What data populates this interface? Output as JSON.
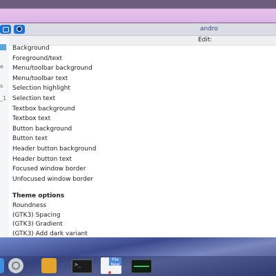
{
  "window": {
    "title": "andro",
    "edit_label": "Edit:",
    "sidebar_fragments": [
      "e",
      "s",
      "_1"
    ]
  },
  "color_items": [
    "Background",
    "Foreground/text",
    "Menu/toolbar background",
    "Menu/toolbar text",
    "Selection highlight",
    "Selection text",
    "Textbox background",
    "Textbox text",
    "Button background",
    "Button text",
    "Header button background",
    "Header button text",
    "Focused window border",
    "Unfocused window border"
  ],
  "theme_options": {
    "title": "Theme options",
    "items": [
      "Roundness",
      "(GTK3) Spacing",
      "(GTK3) Gradient",
      "(GTK3) Add dark variant"
    ]
  },
  "dock": {
    "file_tag": "File",
    "file_sub": "New"
  },
  "colors": {
    "accent": "#1d6fd8",
    "title_text": "#3a3f8a",
    "top_strip": "#e8c0ec"
  },
  "icons": [
    "edit-icon",
    "record-icon",
    "settings-icon",
    "archive-icon",
    "terminal-icon",
    "file-manager-icon",
    "system-monitor-icon"
  ]
}
